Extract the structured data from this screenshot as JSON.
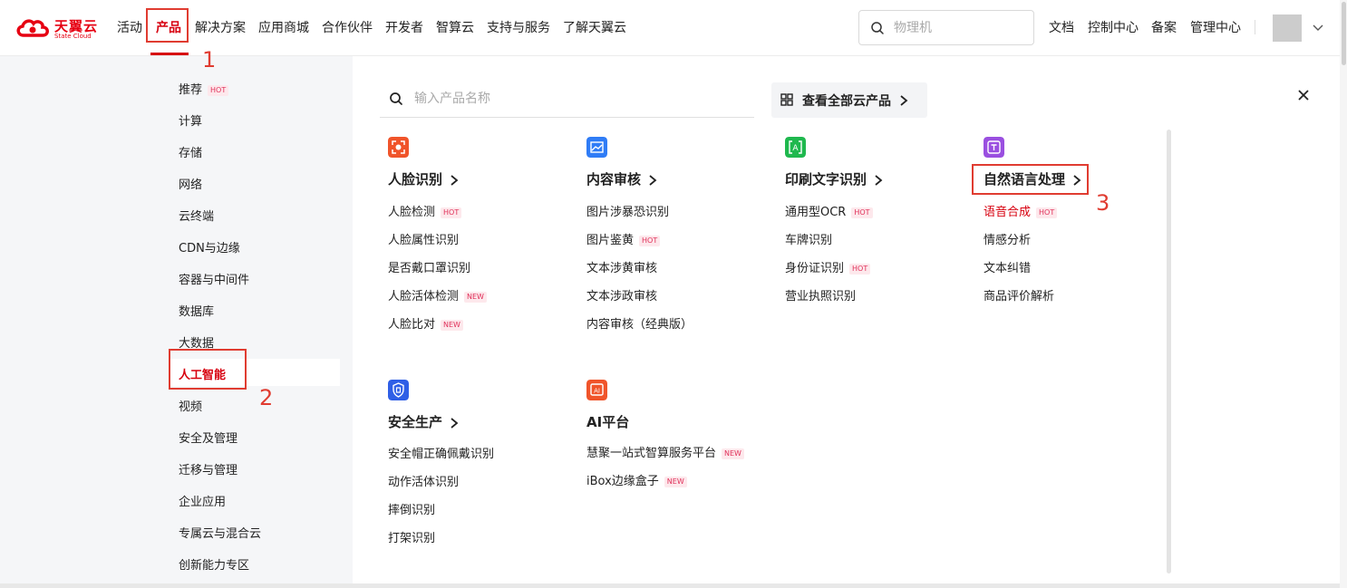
{
  "brand": {
    "name_cn": "天翼云",
    "name_en": "State Cloud",
    "color": "#e60012"
  },
  "nav": [
    "活动",
    "产品",
    "解决方案",
    "应用商城",
    "合作伙伴",
    "开发者",
    "智算云",
    "支持与服务",
    "了解天翼云"
  ],
  "search": {
    "placeholder": "物理机"
  },
  "top_links": [
    "文档",
    "控制中心",
    "备案",
    "管理中心"
  ],
  "sidebar": {
    "items": [
      "推荐",
      "计算",
      "存储",
      "网络",
      "云终端",
      "CDN与边缘",
      "容器与中间件",
      "数据库",
      "大数据",
      "人工智能",
      "视频",
      "安全及管理",
      "迁移与管理",
      "企业应用",
      "专属云与混合云",
      "创新能力专区"
    ],
    "active": "人工智能"
  },
  "tags": {
    "hot": "HOT",
    "new": "NEW"
  },
  "panel": {
    "search_placeholder": "输入产品名称",
    "view_all": "查看全部云产品"
  },
  "categories": [
    {
      "title": "人脸识别",
      "icon": "face-scan-icon",
      "color": "#f0542a",
      "products": [
        "人脸检测",
        "人脸属性识别",
        "是否戴口罩识别",
        "人脸活体检测",
        "人脸比对"
      ]
    },
    {
      "title": "内容审核",
      "icon": "image-review-icon",
      "color": "#2f7cf6",
      "products": [
        "图片涉暴恐识别",
        "图片鉴黄",
        "文本涉黄审核",
        "文本涉政审核",
        "内容审核（经典版）"
      ]
    },
    {
      "title": "印刷文字识别",
      "icon": "ocr-icon",
      "color": "#1fb84e",
      "products": [
        "通用型OCR",
        "车牌识别",
        "身份证识别",
        "营业执照识别"
      ]
    },
    {
      "title": "自然语言处理",
      "icon": "text-nlp-icon",
      "color": "#9a4fe0",
      "products": [
        "语音合成",
        "情感分析",
        "文本纠错",
        "商品评价解析"
      ]
    },
    {
      "title": "安全生产",
      "icon": "shield-icon",
      "color": "#2f5fe6",
      "products": [
        "安全帽正确佩戴识别",
        "动作活体识别",
        "摔倒识别",
        "打架识别"
      ]
    },
    {
      "title": "AI平台",
      "icon": "ai-platform-icon",
      "color": "#f0542a",
      "products": [
        "慧聚一站式智算服务平台",
        "iBox边缘盒子"
      ]
    }
  ],
  "annotations": [
    "1",
    "2",
    "3"
  ],
  "colors": {
    "accent": "#d7000f",
    "annotation": "#e03c31",
    "sidebar_bg": "#f5f6f8"
  }
}
